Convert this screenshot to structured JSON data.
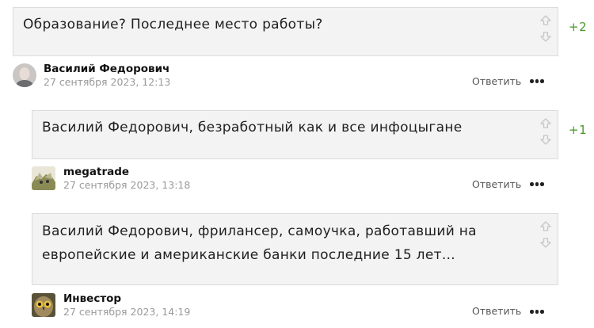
{
  "comments": [
    {
      "text_lines": [
        "Образование? Последнее место работы?"
      ],
      "score": "+2",
      "author": "Василий Федорович",
      "date": "27 сентября 2023, 12:13",
      "reply_label": "Ответить",
      "avatar_icon": "portrait-avatar-icon"
    },
    {
      "text_lines": [
        "Василий Федорович, безработный как и все инфоцыгане"
      ],
      "score": "+1",
      "author": "megatrade",
      "date": "27 сентября 2023, 13:18",
      "reply_label": "Ответить",
      "avatar_icon": "cat-avatar-icon"
    },
    {
      "text_lines": [
        "Василий Федорович, фрилансер, самоучка, работавший на",
        "европейские и американские банки последние 15 лет…"
      ],
      "score": "",
      "author": "Инвестор",
      "date": "27 сентября 2023, 14:19",
      "reply_label": "Ответить",
      "avatar_icon": "owl-avatar-icon"
    }
  ],
  "icons": {
    "upvote": "arrow-up-icon",
    "downvote": "arrow-down-icon",
    "more": "more-dots-icon"
  },
  "colors": {
    "bubble_bg": "#f3f3f3",
    "bubble_border": "#dcdcdc",
    "score": "#4a9a2a",
    "date": "#9a9a9a"
  }
}
